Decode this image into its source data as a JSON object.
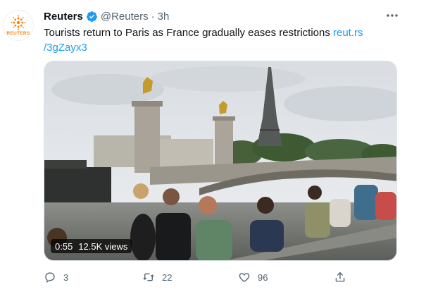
{
  "tweet": {
    "author_name": "Reuters",
    "handle": "@Reuters",
    "separator": "·",
    "time": "3h",
    "avatar_wordmark": "REUTERS",
    "text": "Tourists return to Paris as France gradually eases restrictions ",
    "link_line1": "reut.rs",
    "link_line2": "/3gZayx3"
  },
  "video": {
    "duration": "0:55",
    "views": "12.5K views"
  },
  "actions": {
    "replies": "3",
    "retweets": "22",
    "likes": "96"
  },
  "colors": {
    "accent": "#1d9bf0",
    "brand": "#ff8000",
    "muted": "#536471"
  },
  "icons": [
    "reuters-logo-icon",
    "verified-badge-icon",
    "more-options-icon",
    "reply-icon",
    "retweet-icon",
    "like-icon",
    "share-icon"
  ]
}
